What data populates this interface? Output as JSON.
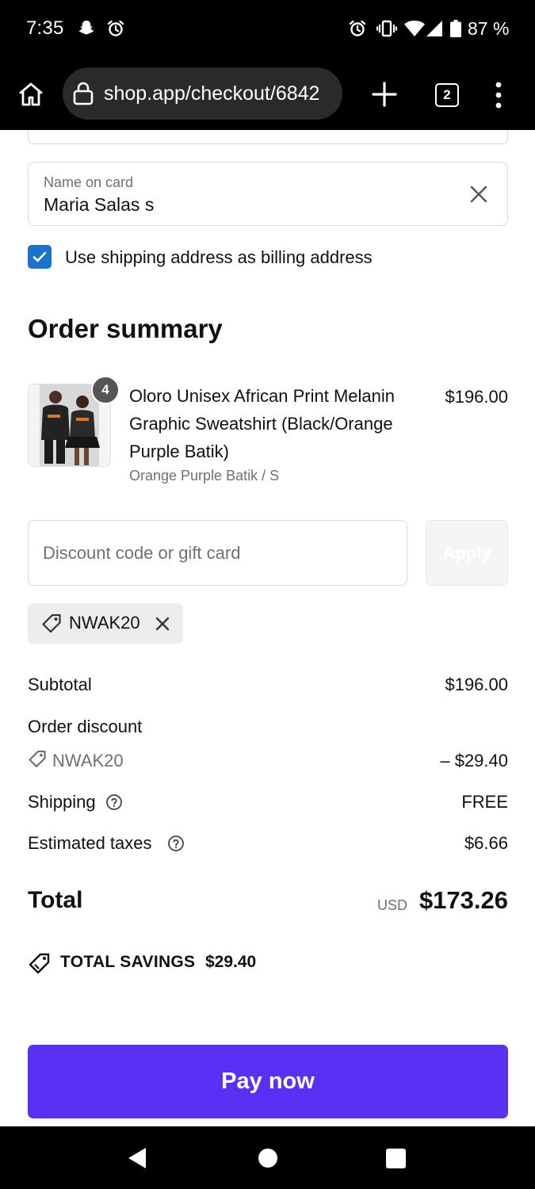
{
  "status_bar": {
    "time": "7:35",
    "battery": "87 %",
    "icons": [
      "snapchat-icon",
      "alarm-icon",
      "alarm-icon",
      "vibrate-icon",
      "wifi-icon",
      "signal-icon",
      "battery-icon"
    ]
  },
  "browser": {
    "url": "shop.app/checkout/6842",
    "tab_count": "2"
  },
  "form": {
    "name_on_card_label": "Name on card",
    "name_on_card_value": "Maria Salas s",
    "billing_checkbox_label": "Use shipping address as billing address",
    "billing_checked": true
  },
  "order_summary": {
    "title": "Order summary",
    "item": {
      "quantity": "4",
      "name": "Oloro Unisex African Print Melanin Graphic Sweatshirt (Black/Orange Purple Batik)",
      "variant": "Orange Purple Batik / S",
      "price": "$196.00"
    },
    "discount": {
      "placeholder": "Discount code or gift card",
      "apply_label": "Apply",
      "applied_code": "NWAK20"
    },
    "rows": {
      "subtotal_label": "Subtotal",
      "subtotal_value": "$196.00",
      "order_discount_label": "Order discount",
      "discount_code": "NWAK20",
      "discount_value": "– $29.40",
      "shipping_label": "Shipping",
      "shipping_value": "FREE",
      "taxes_label": "Estimated taxes",
      "taxes_value": "$6.66"
    },
    "total": {
      "label": "Total",
      "currency": "USD",
      "value": "$173.26"
    },
    "savings": {
      "label": "TOTAL SAVINGS",
      "value": "$29.40"
    },
    "pay_label": "Pay now"
  },
  "colors": {
    "accent": "#5a31f4",
    "checkbox": "#1a73c8"
  }
}
